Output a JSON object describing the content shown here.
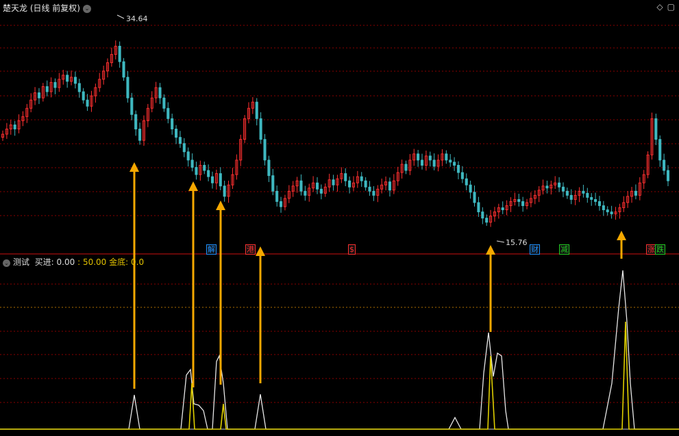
{
  "top_panel": {
    "title": "楚天龙 (日线 前复权)",
    "dropdown_icon": "chevron-down-icon",
    "icons": [
      "diamond-icon",
      "panel-toggle-icon"
    ],
    "high_label": "34.64",
    "low_label": "15.76",
    "badges": [
      {
        "text": "解",
        "color": "#1e90ff"
      },
      {
        "text": "港",
        "color": "#ff3030"
      },
      {
        "text": "$",
        "color": "#ff3030"
      },
      {
        "text": "财",
        "color": "#1e90ff"
      },
      {
        "text": "减",
        "color": "#22cc22"
      },
      {
        "text": "涨",
        "color": "#ff3030"
      },
      {
        "text": "跌",
        "color": "#22cc22"
      }
    ]
  },
  "indicator_panel": {
    "name": "测试",
    "buy_label": "买进",
    "buy_value": "0.00",
    "level_value": "50.00",
    "gold_label": "金底",
    "gold_value": "0.0"
  },
  "colors": {
    "up": "#ff3030",
    "down": "#3fb8c0",
    "grid": "#8b0000",
    "arrow": "#f5a800",
    "white_line": "#e8e8e8",
    "yellow_line": "#e0d000"
  },
  "chart_data": {
    "type": "line",
    "series": [
      {
        "values": [
          24.5,
          25.0,
          25.4,
          25.0,
          25.8,
          26.2,
          27.0,
          27.8,
          28.5,
          28.0,
          29.1,
          28.6,
          29.5,
          29.0,
          29.8,
          30.2,
          29.6,
          30.0,
          29.4,
          28.6,
          27.8,
          27.2,
          28.2,
          29.0,
          29.8,
          30.6,
          31.4,
          32.2,
          33.0,
          31.5,
          30.0,
          28.0,
          26.4,
          25.0,
          23.9,
          25.8,
          27.0,
          28.0,
          29.0,
          28.0,
          27.0,
          26.0,
          25.0,
          24.2,
          23.6,
          22.8,
          22.0,
          21.3,
          20.6,
          21.5,
          21.0,
          20.4,
          19.8,
          20.7,
          19.5,
          18.5,
          19.6,
          20.6,
          22.0,
          24.0,
          26.0,
          27.0,
          27.6,
          26.0,
          24.0,
          22.0,
          20.5,
          19.0,
          18.0,
          17.5,
          18.3,
          19.0,
          19.5,
          20.0,
          19.0,
          18.6,
          19.3,
          19.8,
          19.2,
          18.8,
          19.4,
          20.1,
          19.6,
          20.2,
          20.7,
          20.0,
          19.4,
          19.8,
          20.4,
          20.0,
          19.4,
          19.0,
          18.6,
          19.2,
          19.6,
          19.9,
          19.1,
          20.0,
          20.8,
          21.6,
          21.0,
          22.0,
          22.6,
          22.0,
          21.5,
          22.4,
          22.0,
          21.4,
          22.0,
          22.6,
          22.0,
          21.8,
          21.5,
          20.8,
          20.2,
          19.6,
          18.9,
          17.9,
          17.0,
          16.4,
          16.0,
          16.6,
          17.0,
          17.4,
          17.2,
          17.6,
          18.0,
          18.2,
          18.0,
          17.6,
          17.9,
          18.3,
          18.6,
          19.1,
          19.5,
          19.3,
          19.6,
          19.8,
          19.4,
          19.0,
          18.6,
          18.2,
          18.6,
          19.0,
          18.8,
          18.4,
          18.2,
          18.0,
          17.6,
          17.2,
          17.0,
          16.8,
          17.0,
          17.4,
          17.9,
          18.5,
          19.0,
          18.6,
          19.8,
          20.6,
          22.5,
          26.0,
          24.0,
          22.0,
          21.0,
          20.0
        ]
      }
    ]
  }
}
